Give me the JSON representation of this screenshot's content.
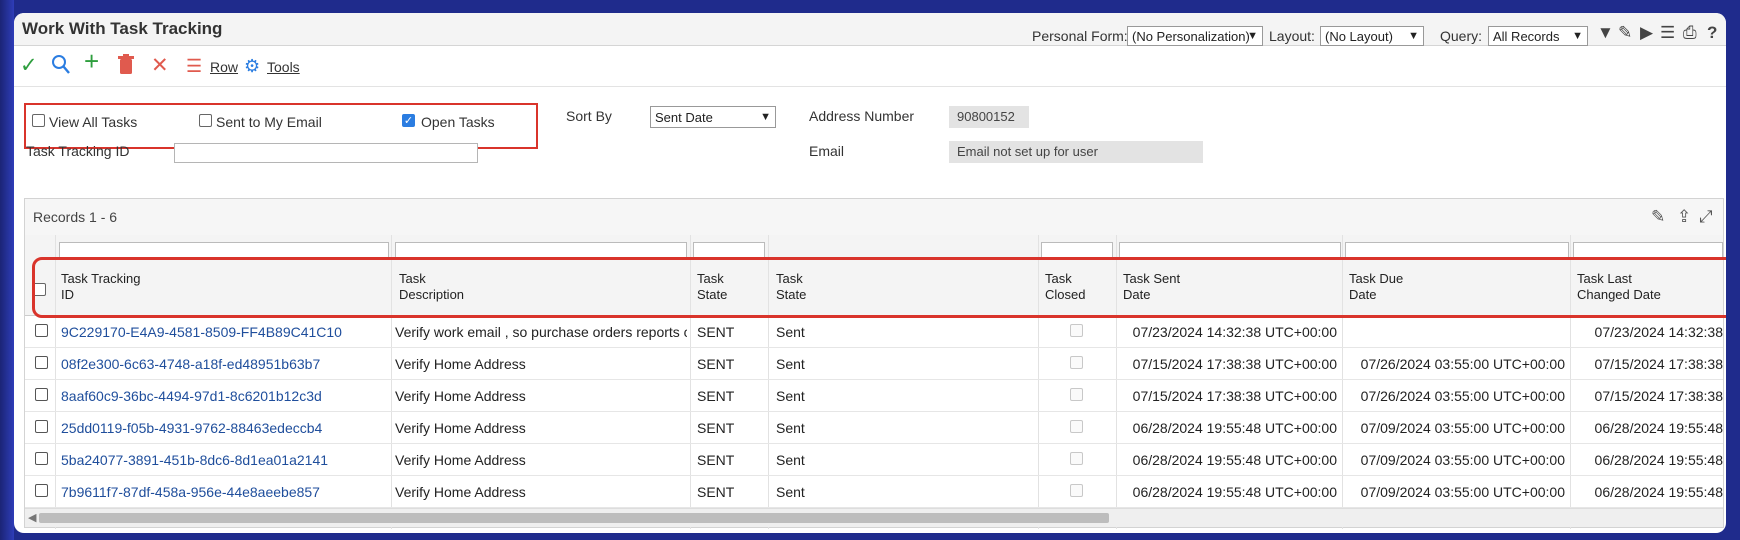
{
  "app": {
    "title": "Work With Task Tracking",
    "personal_form_label": "Personal Form:",
    "personal_form_value": "(No Personalization)",
    "layout_label": "Layout:",
    "layout_value": "(No Layout)",
    "query_label": "Query:",
    "query_value": "All Records",
    "help_label": "?"
  },
  "toolbar": {
    "row_label": "Row",
    "tools_label": "Tools"
  },
  "filters": {
    "view_all_tasks": {
      "label": "View All Tasks",
      "checked": false
    },
    "sent_to_my_email": {
      "label": "Sent to My Email",
      "checked": false
    },
    "open_tasks": {
      "label": "Open Tasks",
      "checked": true
    },
    "sort_by_label": "Sort By",
    "sort_by_value": "Sent Date",
    "address_number_label": "Address Number",
    "address_number_value": "90800152",
    "task_tracking_id_label": "Task Tracking ID",
    "task_tracking_id_value": "",
    "email_label": "Email",
    "email_value": "Email not set up for user"
  },
  "grid": {
    "records_label": "Records 1 - 6",
    "columns": [
      {
        "line1": "Task Tracking",
        "line2": "ID"
      },
      {
        "line1": "Task",
        "line2": "Description"
      },
      {
        "line1": "Task",
        "line2": "State"
      },
      {
        "line1": "Task",
        "line2": "State"
      },
      {
        "line1": "Task",
        "line2": "Closed"
      },
      {
        "line1": "Task Sent",
        "line2": "Date"
      },
      {
        "line1": "Task Due",
        "line2": "Date"
      },
      {
        "line1": "Task Last",
        "line2": "Changed Date"
      }
    ],
    "rows": [
      {
        "id": "9C229170-E4A9-4581-8509-FF4B89C41C10",
        "description": "Verify work email , so purchase orders reports can ...",
        "state_code": "SENT",
        "state": "Sent",
        "sent": "07/23/2024 14:32:38 UTC+00:00",
        "due": "",
        "changed": "07/23/2024 14:32:38"
      },
      {
        "id": "08f2e300-6c63-4748-a18f-ed48951b63b7",
        "description": "Verify Home Address",
        "state_code": "SENT",
        "state": "Sent",
        "sent": "07/15/2024 17:38:38 UTC+00:00",
        "due": "07/26/2024 03:55:00 UTC+00:00",
        "changed": "07/15/2024 17:38:38"
      },
      {
        "id": "8aaf60c9-36bc-4494-97d1-8c6201b12c3d",
        "description": "Verify Home Address",
        "state_code": "SENT",
        "state": "Sent",
        "sent": "07/15/2024 17:38:38 UTC+00:00",
        "due": "07/26/2024 03:55:00 UTC+00:00",
        "changed": "07/15/2024 17:38:38"
      },
      {
        "id": "25dd0119-f05b-4931-9762-88463edeccb4",
        "description": "Verify Home Address",
        "state_code": "SENT",
        "state": "Sent",
        "sent": "06/28/2024 19:55:48 UTC+00:00",
        "due": "07/09/2024 03:55:00 UTC+00:00",
        "changed": "06/28/2024 19:55:48"
      },
      {
        "id": "5ba24077-3891-451b-8dc6-8d1ea01a2141",
        "description": "Verify Home Address",
        "state_code": "SENT",
        "state": "Sent",
        "sent": "06/28/2024 19:55:48 UTC+00:00",
        "due": "07/09/2024 03:55:00 UTC+00:00",
        "changed": "06/28/2024 19:55:48"
      },
      {
        "id": "7b9611f7-87df-458a-956e-44e8aeebe857",
        "description": "Verify Home Address",
        "state_code": "SENT",
        "state": "Sent",
        "sent": "06/28/2024 19:55:48 UTC+00:00",
        "due": "07/09/2024 03:55:00 UTC+00:00",
        "changed": "06/28/2024 19:55:48"
      }
    ]
  },
  "colors": {
    "accent_red": "#d9342b",
    "link_blue": "#1f4e9c",
    "background": "#1f2b8c"
  }
}
